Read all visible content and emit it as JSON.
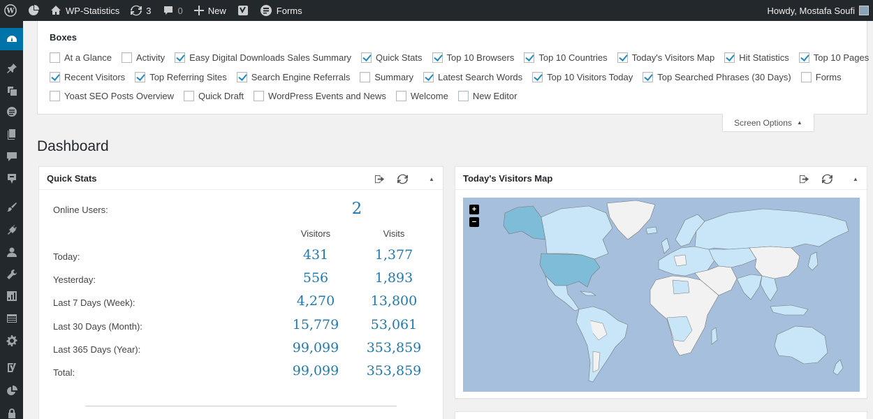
{
  "adminbar": {
    "site_name": "WP-Statistics",
    "updates_count": "3",
    "comments_count": "0",
    "new_label": "New",
    "forms_label": "Forms",
    "howdy": "Howdy, Mostafa Soufi"
  },
  "screen_options": {
    "boxes_title": "Boxes",
    "tab_label": "Screen Options",
    "rows": [
      [
        {
          "label": "At a Glance",
          "checked": false
        },
        {
          "label": "Activity",
          "checked": false
        },
        {
          "label": "Easy Digital Downloads Sales Summary",
          "checked": true
        },
        {
          "label": "Quick Stats",
          "checked": true
        },
        {
          "label": "Top 10 Browsers",
          "checked": true
        },
        {
          "label": "Top 10 Countries",
          "checked": true
        },
        {
          "label": "Today's Visitors Map",
          "checked": true
        },
        {
          "label": "Hit Statistics",
          "checked": true
        },
        {
          "label": "Top 10 Pages",
          "checked": true
        }
      ],
      [
        {
          "label": "Recent Visitors",
          "checked": true
        },
        {
          "label": "Top Referring Sites",
          "checked": true
        },
        {
          "label": "Search Engine Referrals",
          "checked": true
        },
        {
          "label": "Summary",
          "checked": false
        },
        {
          "label": "Latest Search Words",
          "checked": true
        },
        {
          "label": "Top 10 Visitors Today",
          "checked": true
        },
        {
          "label": "Top Searched Phrases (30 Days)",
          "checked": true
        },
        {
          "label": "Forms",
          "checked": false
        }
      ],
      [
        {
          "label": "Yoast SEO Posts Overview",
          "checked": false
        },
        {
          "label": "Quick Draft",
          "checked": false
        },
        {
          "label": "WordPress Events and News",
          "checked": false
        },
        {
          "label": "Welcome",
          "checked": false
        },
        {
          "label": "New Editor",
          "checked": false
        }
      ]
    ]
  },
  "page": {
    "title": "Dashboard"
  },
  "quick_stats": {
    "title": "Quick Stats",
    "online_label": "Online Users:",
    "online_value": "2",
    "col_visitors": "Visitors",
    "col_visits": "Visits",
    "rows": [
      {
        "label": "Today:",
        "visitors": "431",
        "visits": "1,377"
      },
      {
        "label": "Yesterday:",
        "visitors": "556",
        "visits": "1,893"
      },
      {
        "label": "Last 7 Days (Week):",
        "visitors": "4,270",
        "visits": "13,800"
      },
      {
        "label": "Last 30 Days (Month):",
        "visitors": "15,779",
        "visits": "53,061"
      },
      {
        "label": "Last 365 Days (Year):",
        "visitors": "99,099",
        "visits": "353,859"
      },
      {
        "label": "Total:",
        "visitors": "99,099",
        "visits": "353,859"
      }
    ]
  },
  "visitors_map": {
    "title": "Today's Visitors Map",
    "zoom_in": "+",
    "zoom_out": "−"
  },
  "colors": {
    "accent": "#0073aa",
    "number": "#1f7ab3",
    "ocean": "#a5bfdd",
    "land": "#c8e6f7",
    "land_highlight": "#7fbcd8"
  },
  "menu_icons": [
    "dashboard-icon",
    "pin-icon",
    "media-icon",
    "pages-icon",
    "posts-icon",
    "comments-icon",
    "feedback-icon",
    "appearance-icon",
    "plugins-icon",
    "users-icon",
    "tools-icon",
    "statistics-icon",
    "table-icon",
    "settings-icon",
    "yoast-icon",
    "chart-icon",
    "lock-icon"
  ]
}
